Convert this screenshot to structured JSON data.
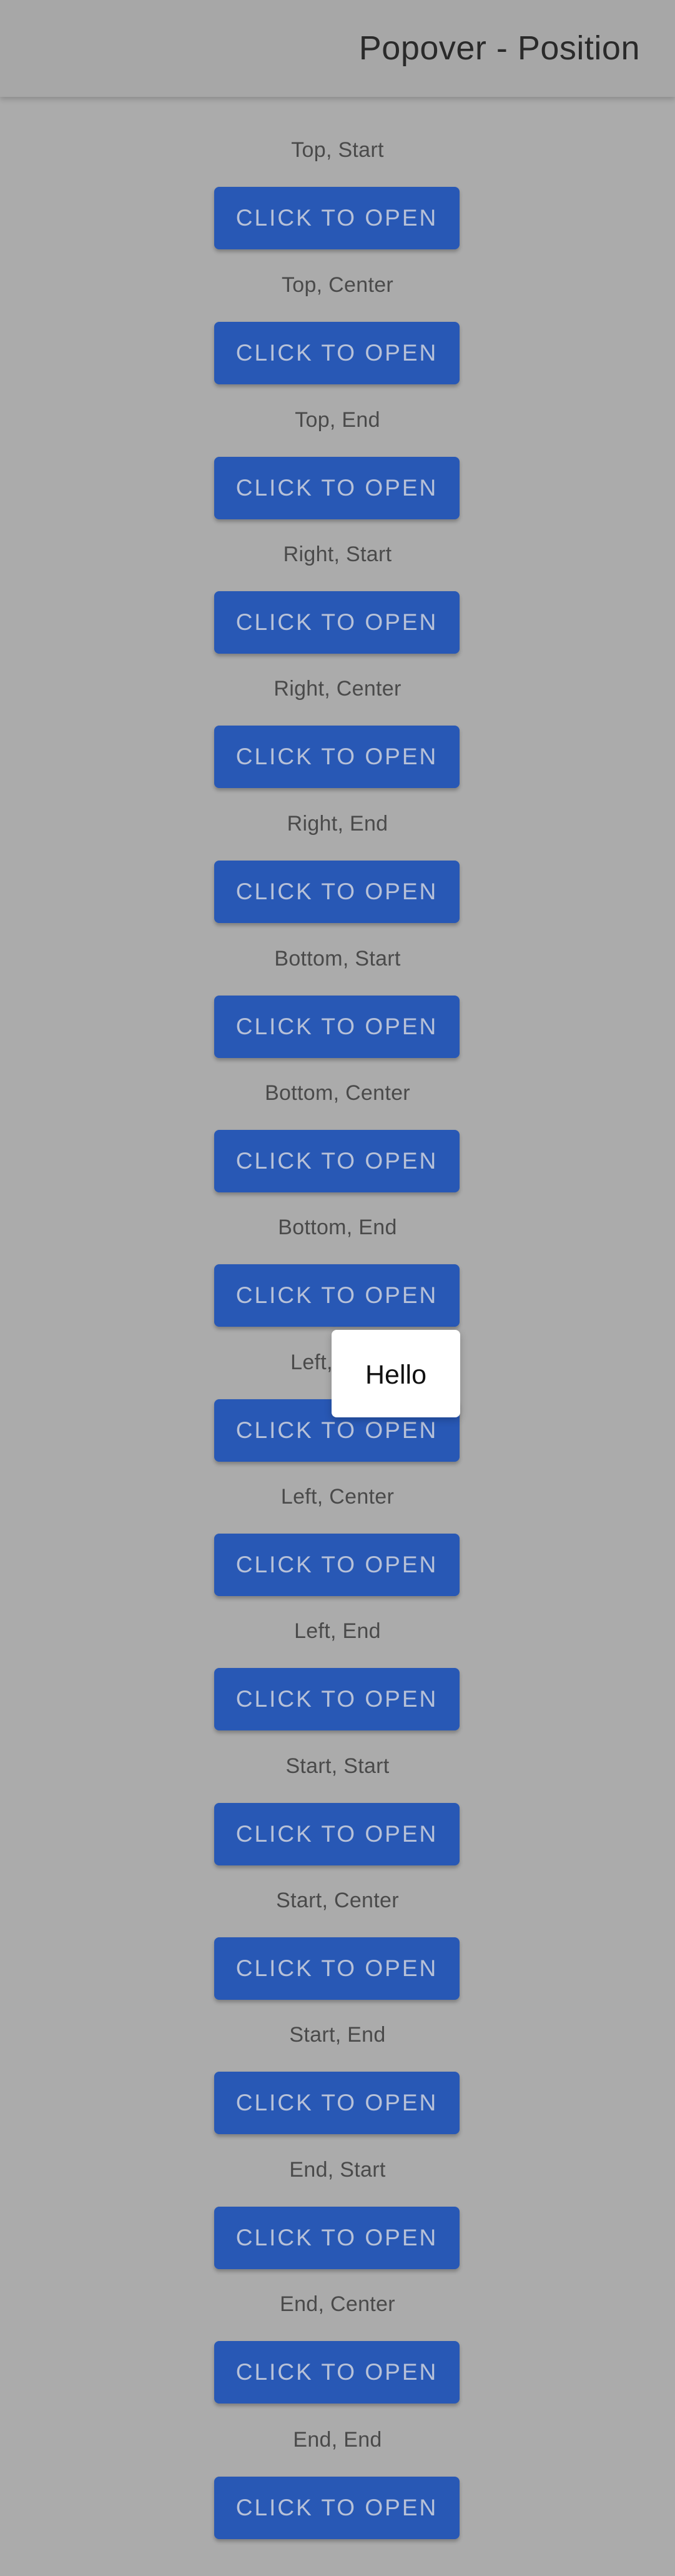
{
  "header": {
    "title": "Popover - Position"
  },
  "rows": [
    {
      "label": "Top, Start",
      "button": "CLICK TO OPEN"
    },
    {
      "label": "Top, Center",
      "button": "CLICK TO OPEN"
    },
    {
      "label": "Top, End",
      "button": "CLICK TO OPEN"
    },
    {
      "label": "Right, Start",
      "button": "CLICK TO OPEN"
    },
    {
      "label": "Right, Center",
      "button": "CLICK TO OPEN"
    },
    {
      "label": "Right, End",
      "button": "CLICK TO OPEN"
    },
    {
      "label": "Bottom, Start",
      "button": "CLICK TO OPEN"
    },
    {
      "label": "Bottom, Center",
      "button": "CLICK TO OPEN"
    },
    {
      "label": "Bottom, End",
      "button": "CLICK TO OPEN"
    },
    {
      "label": "Left, Start",
      "button": "CLICK TO OPEN"
    },
    {
      "label": "Left, Center",
      "button": "CLICK TO OPEN"
    },
    {
      "label": "Left, End",
      "button": "CLICK TO OPEN"
    },
    {
      "label": "Start, Start",
      "button": "CLICK TO OPEN"
    },
    {
      "label": "Start, Center",
      "button": "CLICK TO OPEN"
    },
    {
      "label": "Start, End",
      "button": "CLICK TO OPEN"
    },
    {
      "label": "End, Start",
      "button": "CLICK TO OPEN"
    },
    {
      "label": "End, Center",
      "button": "CLICK TO OPEN"
    },
    {
      "label": "End, End",
      "button": "CLICK TO OPEN"
    }
  ],
  "popover": {
    "text": "Hello"
  },
  "colors": {
    "backdrop": "#ababab",
    "button": "#2858b5",
    "button_text": "#b7c1d8",
    "popover": "#ffffff"
  }
}
